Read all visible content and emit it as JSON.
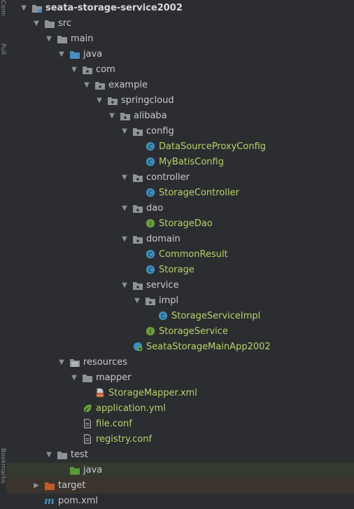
{
  "gutter": {
    "top_label": "Commit",
    "mid_label": "Pull Requests",
    "bottom_label": "Bookmarks"
  },
  "tree": {
    "root": "seata-storage-service2002",
    "src": "src",
    "main": "main",
    "java": "java",
    "com": "com",
    "example": "example",
    "springcloud": "springcloud",
    "alibaba": "alibaba",
    "config": "config",
    "datasource_proxy_config": "DataSourceProxyConfig",
    "mybatis_config": "MyBatisConfig",
    "controller": "controller",
    "storage_controller": "StorageController",
    "dao": "dao",
    "storage_dao": "StorageDao",
    "domain": "domain",
    "common_result": "CommonResult",
    "storage": "Storage",
    "service": "service",
    "impl": "impl",
    "storage_service_impl": "StorageServiceImpl",
    "storage_service": "StorageService",
    "main_app": "SeataStorageMainApp2002",
    "resources": "resources",
    "mapper": "mapper",
    "storage_mapper_xml": "StorageMapper.xml",
    "application_yml": "application.yml",
    "file_conf": "file.conf",
    "registry_conf": "registry.conf",
    "test": "test",
    "test_java": "java",
    "target": "target",
    "pom_xml": "pom.xml"
  },
  "colors": {
    "background": "#2b2d30",
    "folder": "#8f9296",
    "source_folder": "#4a8fc2",
    "resources_folder": "#a9a9a9",
    "test_folder": "#5a9a3a",
    "excluded_folder": "#c15a2b",
    "class_icon": "#3d8fbf",
    "interface_icon": "#6a9f3a",
    "spring_green": "#6ca13f",
    "name_green": "#b8d26a"
  }
}
